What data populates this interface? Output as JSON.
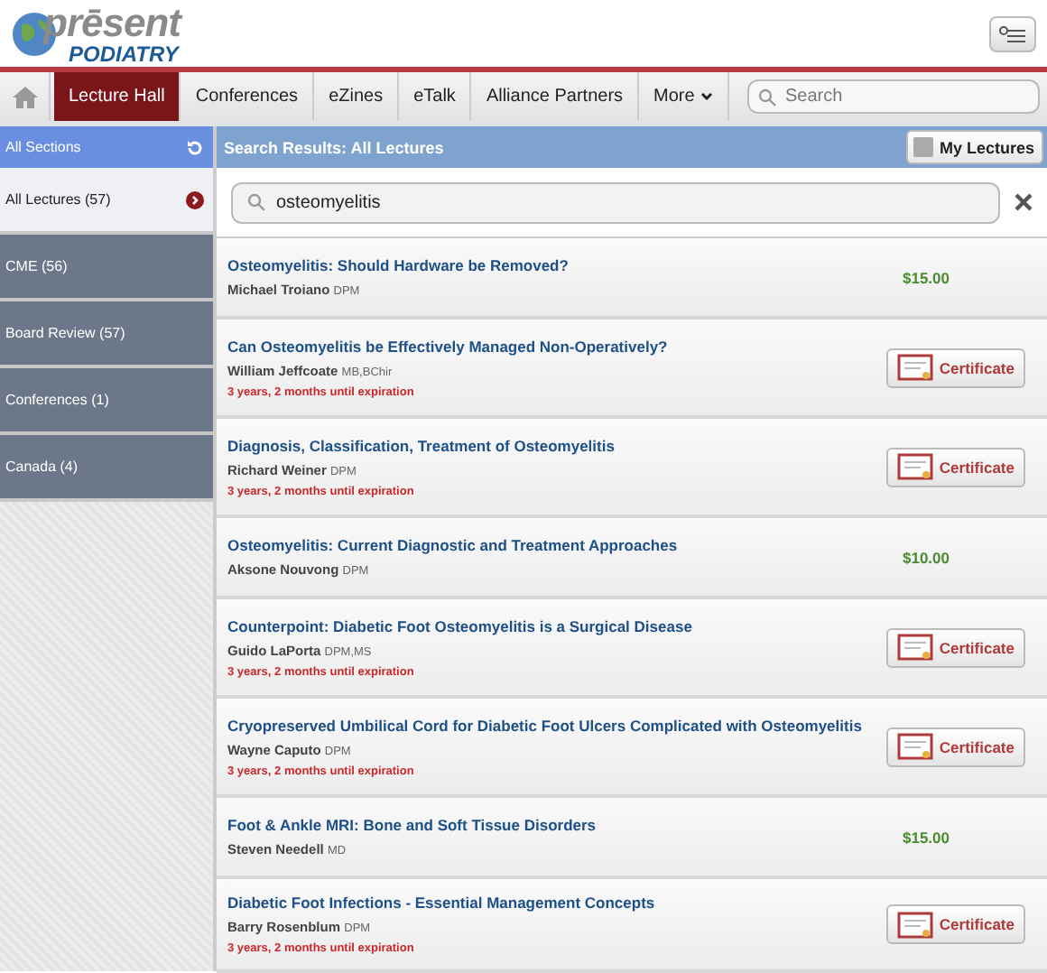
{
  "logo": {
    "top": "prēsent",
    "bottom": "PODIATRY"
  },
  "nav": {
    "tabs": [
      {
        "label": "Lecture Hall",
        "selected": true
      },
      {
        "label": "Conferences",
        "selected": false
      },
      {
        "label": "eZines",
        "selected": false
      },
      {
        "label": "eTalk",
        "selected": false
      },
      {
        "label": "Alliance Partners",
        "selected": false
      },
      {
        "label": "More",
        "selected": false,
        "dropdown": true
      }
    ],
    "search": {
      "placeholder": "Search"
    }
  },
  "sidebar": {
    "title": "All Sections",
    "items": [
      {
        "label": "All Lectures (57)",
        "selected": true
      },
      {
        "label": "CME (56)",
        "selected": false
      },
      {
        "label": "Board Review (57)",
        "selected": false
      },
      {
        "label": "Conferences (1)",
        "selected": false
      },
      {
        "label": "Canada (4)",
        "selected": false
      }
    ]
  },
  "results": {
    "title": "Search Results: All Lectures",
    "my_lectures": {
      "label": "My Lectures",
      "checked": false
    },
    "query": "osteomyelitis",
    "lectures": [
      {
        "title": "Osteomyelitis: Should Hardware be Removed?",
        "author": "Michael Troiano",
        "credentials": "DPM",
        "kind": "price",
        "price": "$15.00"
      },
      {
        "title": "Can Osteomyelitis be Effectively Managed Non-Operatively?",
        "author": "William Jeffcoate",
        "credentials": "MB,BChir",
        "expiration": "3 years, 2 months until expiration",
        "kind": "certificate",
        "action": "Certificate"
      },
      {
        "title": "Diagnosis, Classification, Treatment of Osteomyelitis",
        "author": "Richard Weiner",
        "credentials": "DPM",
        "expiration": "3 years, 2 months until expiration",
        "kind": "certificate",
        "action": "Certificate"
      },
      {
        "title": "Osteomyelitis: Current Diagnostic and Treatment Approaches",
        "author": "Aksone Nouvong",
        "credentials": "DPM",
        "kind": "price",
        "price": "$10.00"
      },
      {
        "title": "Counterpoint: Diabetic Foot Osteomyelitis is a Surgical Disease",
        "author": "Guido LaPorta",
        "credentials": "DPM,MS",
        "expiration": "3 years, 2 months until expiration",
        "kind": "certificate",
        "action": "Certificate"
      },
      {
        "title": "Cryopreserved Umbilical Cord for Diabetic Foot Ulcers Complicated with Osteomyelitis",
        "author": "Wayne Caputo",
        "credentials": "DPM",
        "expiration": "3 years, 2 months until expiration",
        "kind": "certificate",
        "action": "Certificate"
      },
      {
        "title": "Foot & Ankle MRI: Bone and Soft Tissue Disorders",
        "author": "Steven Needell",
        "credentials": "MD",
        "kind": "price",
        "price": "$15.00"
      },
      {
        "title": "Diabetic Foot Infections - Essential Management Concepts",
        "author": "Barry Rosenblum",
        "credentials": "DPM",
        "expiration": "3 years, 2 months until expiration",
        "kind": "certificate",
        "action": "Certificate"
      }
    ]
  }
}
